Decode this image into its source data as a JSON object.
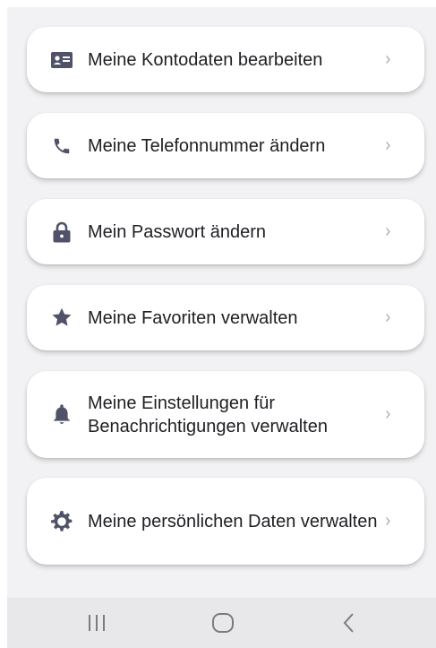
{
  "menu": {
    "items": [
      {
        "label": "Meine Kontodaten bearbeiten",
        "icon": "id-card-icon"
      },
      {
        "label": "Meine Telefonnummer ändern",
        "icon": "phone-icon"
      },
      {
        "label": "Mein Passwort ändern",
        "icon": "lock-icon"
      },
      {
        "label": "Meine Favoriten verwalten",
        "icon": "star-icon"
      },
      {
        "label": "Meine Einstellungen für Benachrichtigungen verwalten",
        "icon": "bell-icon"
      },
      {
        "label": "Meine persönlichen Daten verwalten",
        "icon": "gear-icon"
      }
    ],
    "chevron": "›"
  },
  "navbar": {
    "buttons": [
      "recent-apps",
      "home",
      "back"
    ]
  },
  "colors": {
    "icon": "#4f5268",
    "background": "#f2f2f4",
    "card": "#ffffff",
    "chevron": "#a9a9b2"
  }
}
